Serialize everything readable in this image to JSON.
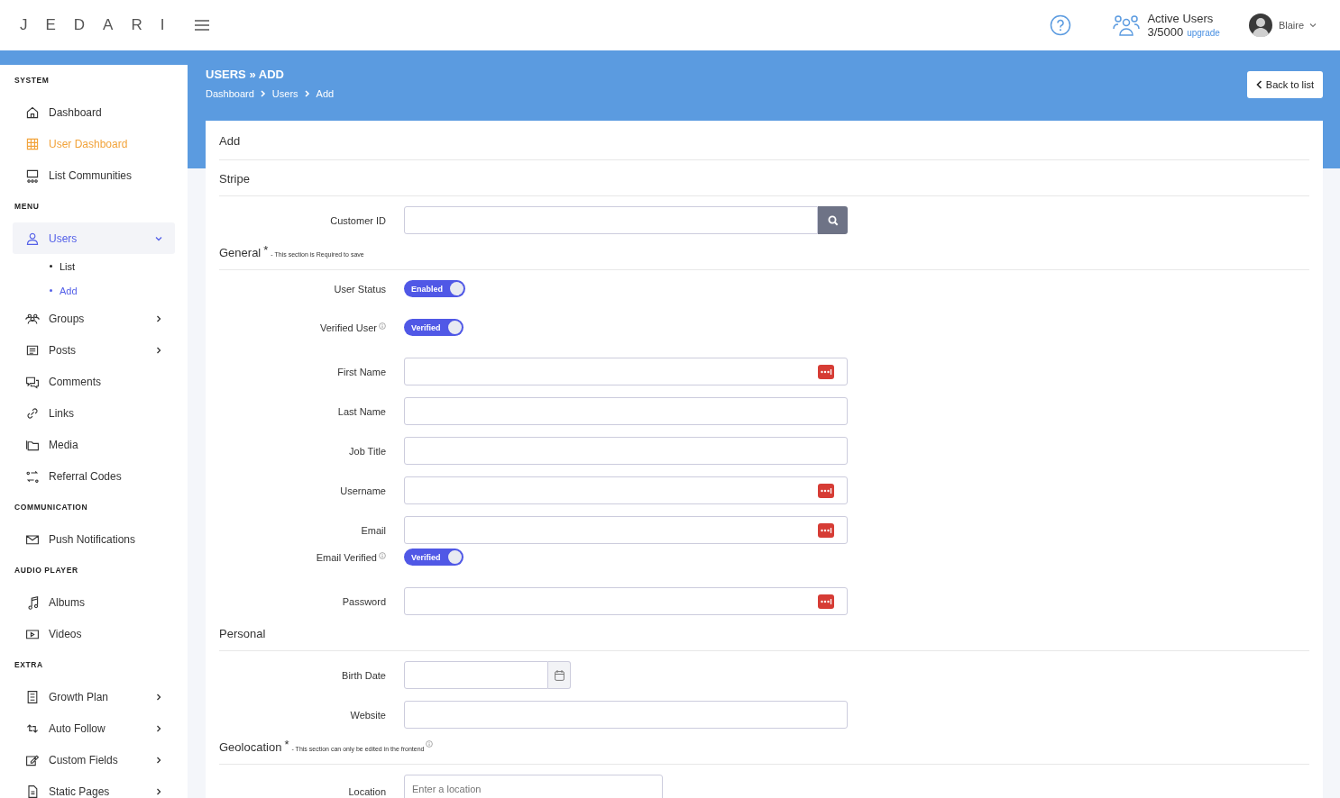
{
  "header": {
    "logo": "JEDARI",
    "active_users": {
      "label": "Active Users",
      "count": "3/5000",
      "link": "upgrade"
    },
    "user": {
      "name": "Blaire"
    }
  },
  "sidebar": [
    {
      "heading": "SYSTEM",
      "items": [
        {
          "label": "Dashboard",
          "selected": false,
          "highlighted": false
        },
        {
          "label": "User Dashboard",
          "selected": false,
          "highlighted": true
        },
        {
          "label": "List Communities",
          "selected": false,
          "highlighted": false
        }
      ]
    },
    {
      "heading": "MENU",
      "items": [
        {
          "label": "Users",
          "selected": true,
          "highlighted": false,
          "expandable": true,
          "expanded": true,
          "children": [
            {
              "label": "List",
              "selected": false
            },
            {
              "label": "Add",
              "selected": true
            }
          ]
        },
        {
          "label": "Groups",
          "selected": false,
          "highlighted": false,
          "expandable": true,
          "expanded": false
        },
        {
          "label": "Posts",
          "selected": false,
          "highlighted": false,
          "expandable": true,
          "expanded": false
        },
        {
          "label": "Comments",
          "selected": false,
          "highlighted": false
        },
        {
          "label": "Links",
          "selected": false,
          "highlighted": false
        },
        {
          "label": "Media",
          "selected": false,
          "highlighted": false
        },
        {
          "label": "Referral Codes",
          "selected": false,
          "highlighted": false
        }
      ]
    },
    {
      "heading": "COMMUNICATION",
      "items": [
        {
          "label": "Push Notifications",
          "selected": false,
          "highlighted": false
        }
      ]
    },
    {
      "heading": "AUDIO PLAYER",
      "items": [
        {
          "label": "Albums",
          "selected": false,
          "highlighted": false
        },
        {
          "label": "Videos",
          "selected": false,
          "highlighted": false
        }
      ]
    },
    {
      "heading": "EXTRA",
      "items": [
        {
          "label": "Growth Plan",
          "selected": false,
          "highlighted": false,
          "expandable": true,
          "expanded": false
        },
        {
          "label": "Auto Follow",
          "selected": false,
          "highlighted": false,
          "expandable": true,
          "expanded": false
        },
        {
          "label": "Custom Fields",
          "selected": false,
          "highlighted": false,
          "expandable": true,
          "expanded": false
        },
        {
          "label": "Static Pages",
          "selected": false,
          "highlighted": false,
          "expandable": true,
          "expanded": false
        }
      ]
    }
  ],
  "page": {
    "title": "USERS » ADD",
    "breadcrumb": [
      "Dashboard",
      "Users",
      "Add"
    ],
    "back_button": "Back to list"
  },
  "form": {
    "title": "Add",
    "sections": [
      {
        "title": "Stripe",
        "fields": [
          {
            "kind": "search",
            "label": "Customer ID"
          }
        ]
      },
      {
        "title": "General",
        "mark": "*",
        "note": "- This section is Required to save",
        "fields": [
          {
            "kind": "toggle",
            "label": "User Status",
            "text": "Enabled",
            "on": true,
            "info": false
          },
          {
            "kind": "toggle",
            "label": "Verified User",
            "text": "Verified",
            "on": true,
            "info": true
          },
          {
            "kind": "input",
            "label": "First Name",
            "autofill": true
          },
          {
            "kind": "input",
            "label": "Last Name",
            "autofill": false
          },
          {
            "kind": "input",
            "label": "Job Title",
            "autofill": false
          },
          {
            "kind": "input",
            "label": "Username",
            "autofill": true
          },
          {
            "kind": "input",
            "label": "Email",
            "autofill": true
          },
          {
            "kind": "toggle",
            "label": "Email Verified",
            "text": "Verified",
            "on": true,
            "info": true
          },
          {
            "kind": "input",
            "label": "Password",
            "autofill": true
          }
        ]
      },
      {
        "title": "Personal",
        "fields": [
          {
            "kind": "date",
            "label": "Birth Date"
          },
          {
            "kind": "input",
            "label": "Website",
            "autofill": false
          }
        ]
      },
      {
        "title": "Geolocation",
        "mark": "*",
        "note": "- This section can only be edited in the frontend",
        "note_info": true,
        "fields": [
          {
            "kind": "location",
            "label": "Location",
            "placeholder": "Enter a location"
          }
        ]
      }
    ]
  }
}
